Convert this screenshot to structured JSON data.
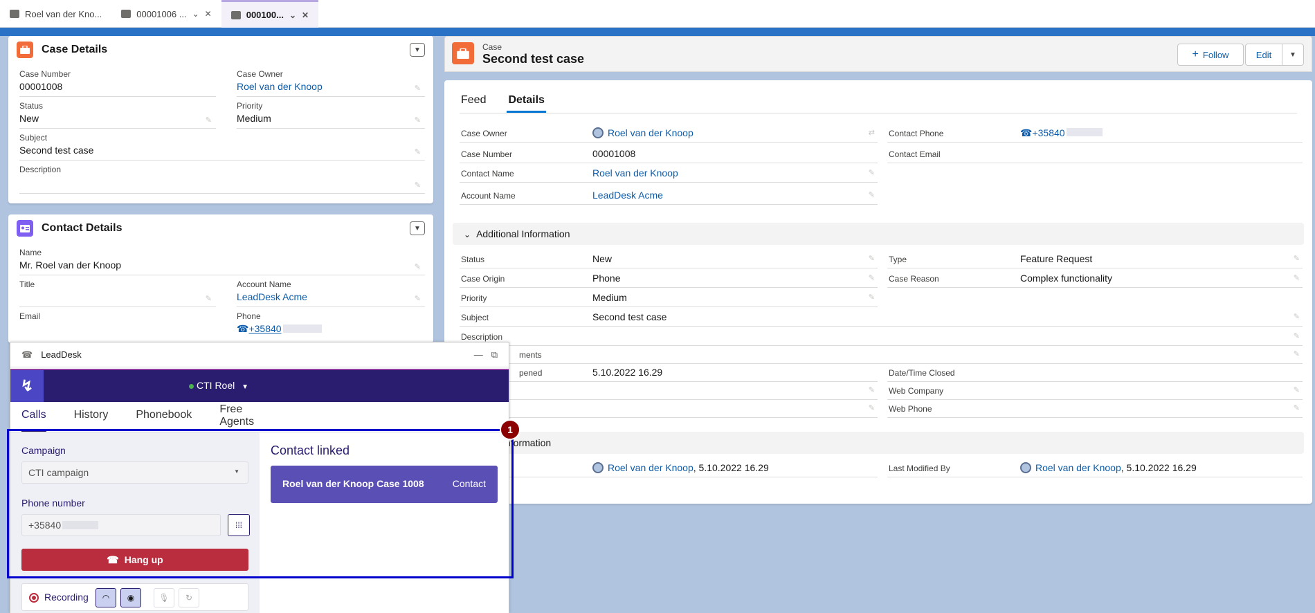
{
  "tabs": [
    {
      "label": "Roel van der Kno...",
      "icon": "contact-card-icon"
    },
    {
      "label": "00001006 ...",
      "icon": "briefcase-icon"
    },
    {
      "label": "000100...",
      "icon": "briefcase-icon"
    }
  ],
  "case_details": {
    "title": "Case Details",
    "fields": {
      "case_number": {
        "label": "Case Number",
        "value": "00001008"
      },
      "case_owner": {
        "label": "Case Owner",
        "value": "Roel van der Knoop"
      },
      "status": {
        "label": "Status",
        "value": "New"
      },
      "priority": {
        "label": "Priority",
        "value": "Medium"
      },
      "subject": {
        "label": "Subject",
        "value": "Second test case"
      },
      "description": {
        "label": "Description",
        "value": ""
      }
    }
  },
  "contact_details": {
    "title": "Contact Details",
    "fields": {
      "name": {
        "label": "Name",
        "value": "Mr. Roel van der Knoop"
      },
      "title": {
        "label": "Title",
        "value": ""
      },
      "account_name": {
        "label": "Account Name",
        "value": "LeadDesk Acme"
      },
      "email": {
        "label": "Email",
        "value": ""
      },
      "phone": {
        "label": "Phone",
        "value": "+35840"
      }
    }
  },
  "record": {
    "object": "Case",
    "title": "Second test case",
    "follow_label": "Follow",
    "edit_label": "Edit",
    "tabs": {
      "feed": "Feed",
      "details": "Details"
    },
    "top_left": [
      {
        "label": "Case Owner",
        "value": "Roel van der Knoop",
        "link": true
      },
      {
        "label": "Case Number",
        "value": "00001008",
        "link": false
      },
      {
        "label": "Contact Name",
        "value": "Roel van der Knoop",
        "link": true
      },
      {
        "label": "Account Name",
        "value": "LeadDesk Acme",
        "link": true
      }
    ],
    "top_right": [
      {
        "label": "Contact Phone",
        "value": "+35840",
        "link": true
      },
      {
        "label": "Contact Email",
        "value": "",
        "link": false
      }
    ],
    "additional_section": "Additional Information",
    "add_left": [
      {
        "label": "Status",
        "value": "New"
      },
      {
        "label": "Case Origin",
        "value": "Phone"
      },
      {
        "label": "Priority",
        "value": "Medium"
      },
      {
        "label": "Subject",
        "value": "Second test case"
      }
    ],
    "add_right": [
      {
        "label": "Type",
        "value": "Feature Request"
      },
      {
        "label": "Case Reason",
        "value": "Complex functionality"
      }
    ],
    "description_partial": "Description",
    "comments_partial": "ments",
    "opened_partial": "pened",
    "opened_value": "5.10.2022 16.29",
    "date_closed_label": "Date/Time Closed",
    "web_company_label": "Web Company",
    "web_phone_label": "Web Phone",
    "system_section_partial": "nformation",
    "created_by_value": "Roel van der Knoop",
    "created_by_date": ", 5.10.2022 16.29",
    "last_modified_label": "Last Modified By",
    "last_modified_value": "Roel van der Knoop",
    "last_modified_date": ", 5.10.2022 16.29"
  },
  "leaddesk": {
    "window_title": "LeadDesk",
    "agent": "CTI Roel",
    "tabs": [
      "Calls",
      "History",
      "Phonebook",
      "Free Agents"
    ],
    "campaign_label": "Campaign",
    "campaign_value": "CTI campaign",
    "phone_label": "Phone number",
    "phone_value": "+35840",
    "hangup_label": "Hang up",
    "recording_label": "Recording",
    "contact_linked_title": "Contact linked",
    "linked_name": "Roel van der Knoop Case 1008",
    "linked_type": "Contact"
  },
  "badge_number": "1",
  "colors": {
    "brand": "#0176d3",
    "case_orange": "#f26c3a",
    "contact_purple": "#7f5ff1",
    "leaddesk_navy": "#2a1c6e",
    "hangup_red": "#ba2d3e",
    "highlight": "#0000cc"
  }
}
